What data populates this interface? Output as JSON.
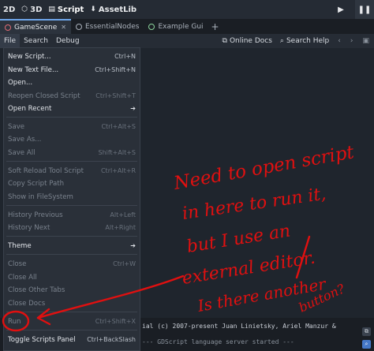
{
  "topbar": {
    "workspaces": [
      {
        "label": "2D",
        "icon": "2d-icon"
      },
      {
        "label": "3D",
        "icon": "3d-icon"
      },
      {
        "label": "Script",
        "icon": "script-icon"
      },
      {
        "label": "AssetLib",
        "icon": "assetlib-icon"
      }
    ],
    "active": "Script"
  },
  "scene_tabs": [
    {
      "label": "GameScene",
      "active": true
    },
    {
      "label": "EssentialNodes",
      "active": false
    },
    {
      "label": "Example Gui",
      "active": false
    }
  ],
  "menubar": {
    "file": "File",
    "search": "Search",
    "debug": "Debug",
    "online_docs": "Online Docs",
    "search_help": "Search Help"
  },
  "file_menu": {
    "new_script": {
      "label": "New Script...",
      "shortcut": "Ctrl+N"
    },
    "new_text_file": {
      "label": "New Text File...",
      "shortcut": "Ctrl+Shift+N"
    },
    "open": {
      "label": "Open...",
      "shortcut": ""
    },
    "reopen_closed": {
      "label": "Reopen Closed Script",
      "shortcut": "Ctrl+Shift+T"
    },
    "open_recent": {
      "label": "Open Recent",
      "shortcut": ""
    },
    "save": {
      "label": "Save",
      "shortcut": "Ctrl+Alt+S"
    },
    "save_as": {
      "label": "Save As...",
      "shortcut": ""
    },
    "save_all": {
      "label": "Save All",
      "shortcut": "Shift+Alt+S"
    },
    "soft_reload": {
      "label": "Soft Reload Tool Script",
      "shortcut": "Ctrl+Alt+R"
    },
    "copy_path": {
      "label": "Copy Script Path",
      "shortcut": ""
    },
    "show_fs": {
      "label": "Show in FileSystem",
      "shortcut": ""
    },
    "history_prev": {
      "label": "History Previous",
      "shortcut": "Alt+Left"
    },
    "history_next": {
      "label": "History Next",
      "shortcut": "Alt+Right"
    },
    "theme": {
      "label": "Theme",
      "shortcut": ""
    },
    "close": {
      "label": "Close",
      "shortcut": "Ctrl+W"
    },
    "close_all": {
      "label": "Close All",
      "shortcut": ""
    },
    "close_other": {
      "label": "Close Other Tabs",
      "shortcut": ""
    },
    "close_docs": {
      "label": "Close Docs",
      "shortcut": ""
    },
    "run": {
      "label": "Run",
      "shortcut": "Ctrl+Shift+X"
    },
    "toggle_panel": {
      "label": "Toggle Scripts Panel",
      "shortcut": "Ctrl+BackSlash"
    }
  },
  "console": {
    "line1": "ial (c) 2007-present Juan Linietsky, Ariel Manzur &",
    "line2": "--- GDScript language server started ---"
  },
  "annotation": {
    "lines": [
      "Need to open script",
      "in here to run it,",
      "but I use an",
      "external editor.",
      "Is there another",
      "button?"
    ],
    "color": "#e01010"
  },
  "colors": {
    "accent": "#6ea5e8",
    "menu_bg": "#2a3039",
    "annotation": "#e01010"
  }
}
